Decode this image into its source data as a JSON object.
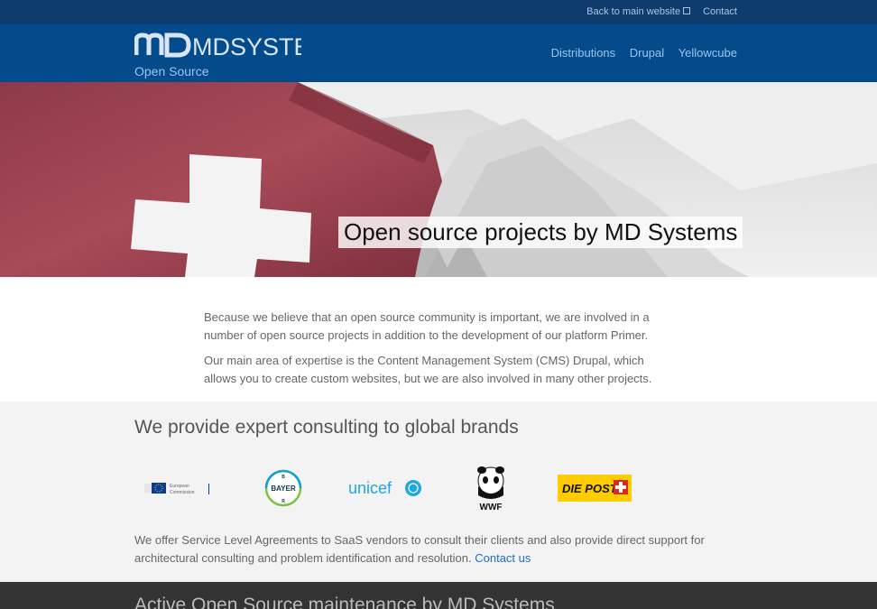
{
  "topbar": {
    "back_link": "Back to main website",
    "contact": "Contact"
  },
  "header": {
    "logo_text": "MDSYSTEMS",
    "logo_sub": "Open Source",
    "nav": [
      "Distributions",
      "Drupal",
      "Yellowcube"
    ]
  },
  "hero": {
    "title": "Open source projects by MD Systems"
  },
  "intro": {
    "p1": "Because we believe that an open source community is important, we are involved in a number of open source projects in addition to the development of our platform Primer.",
    "p2": "Our main area of expertise is the Content Management System (CMS) Drupal, which allows you to create custom websites, but we are also involved in many other projects."
  },
  "consulting": {
    "heading": "We provide expert consulting to global brands",
    "brands": {
      "ec_line1": "European",
      "ec_line2": "Commission",
      "bayer": "BAYER",
      "unicef": "unicef",
      "wwf": "WWF",
      "post": "DIE POST"
    },
    "sla_text": "We offer Service Level Agreements to SaaS vendors to consult their clients and also provide direct support for architectural consulting and problem identification and resolution. ",
    "contact_link": "Contact us"
  },
  "maintenance": {
    "heading": "Active Open Source maintenance by MD Systems"
  },
  "colors": {
    "topbar": "#0d3c6d",
    "header": "#044b8c",
    "nav_link": "#9cc4ef",
    "link": "#1c6fc4",
    "dark_band": "#333333"
  }
}
